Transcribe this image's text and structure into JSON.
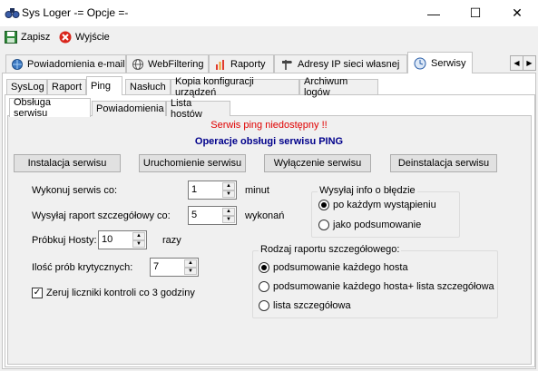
{
  "window": {
    "title": "Sys Loger -= Opcje =-",
    "minimize": "—",
    "maximize": "☐",
    "close": "✕"
  },
  "toolbar": {
    "save_label": "Zapisz",
    "exit_label": "Wyjście"
  },
  "top_tabs": [
    "Powiadomienia e-mail",
    "WebFiltering",
    "Raporty",
    "Adresy IP sieci własnej",
    "Serwisy"
  ],
  "second_tabs": [
    "SysLog",
    "Raport",
    "Ping",
    "Nasłuch",
    "Kopia konfiguracji urządzeń",
    "Archiwum logów"
  ],
  "third_tabs": [
    "Obsługa serwisu",
    "Powiadomienia",
    "Lista hostów"
  ],
  "status_text": "Serwis ping niedostępny !!",
  "section_title": "Operacje obsługi serwisu PING",
  "buttons": [
    "Instalacja serwisu",
    "Uruchomienie serwisu",
    "Wyłączenie serwisu",
    "Deinstalacja serwisu"
  ],
  "fields": {
    "run_every": {
      "label": "Wykonuj serwis co:",
      "value": "1",
      "unit": "minut"
    },
    "send_report": {
      "label": "Wysyłaj raport szczegółowy co:",
      "value": "5",
      "unit": "wykonań"
    },
    "probe_hosts": {
      "label": "Próbkuj Hosty:",
      "value": "10",
      "unit": "razy"
    },
    "critical_probes": {
      "label": "Ilość prób krytycznych:",
      "value": "7"
    }
  },
  "checkbox": {
    "label": "Zeruj liczniki kontroli co 3 godziny",
    "checked": true
  },
  "send_info_group": {
    "title": "Wysyłaj info o błędzie",
    "options": [
      "po każdym wystąpieniu",
      "jako podsumowanie"
    ],
    "selected": 0
  },
  "report_type_group": {
    "title": "Rodzaj raportu szczegółowego:",
    "options": [
      "podsumowanie każdego hosta",
      "podsumowanie każdego hosta+ lista szczegółowa",
      "lista szczegółowa"
    ],
    "selected": 0
  },
  "colors": {
    "status": "#e00000",
    "title": "#00008b"
  }
}
